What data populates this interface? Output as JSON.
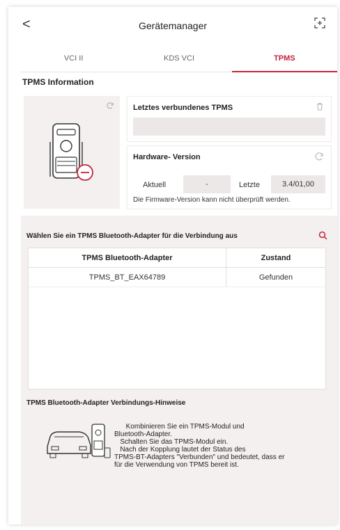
{
  "header": {
    "title": "Gerätemanager",
    "back_glyph": "<"
  },
  "tabs": [
    {
      "label": "VCI II",
      "active": false
    },
    {
      "label": "KDS VCI",
      "active": false
    },
    {
      "label": "TPMS",
      "active": true
    }
  ],
  "tpms_info": {
    "section_title": "TPMS Information",
    "last_connected_label": "Letztes verbundenes TPMS",
    "last_connected_value": "",
    "hardware_label": "Hardware- Version",
    "current_label": "Aktuell",
    "current_value": "-",
    "latest_label": "Letzte",
    "latest_value": "3.4/01,00",
    "firmware_note": "Die Firmware-Version kann nicht überprüft werden."
  },
  "adapter": {
    "select_title": "Wählen Sie ein TPMS Bluetooth-Adapter für die Verbindung aus",
    "col_adapter": "TPMS Bluetooth-Adapter",
    "col_status": "Zustand",
    "rows": [
      {
        "name": "TPMS_BT_EAX64789",
        "status": "Gefunden"
      }
    ]
  },
  "hints": {
    "title": "TPMS Bluetooth-Adapter Verbindungs-Hinweise",
    "lines": [
      "      Kombinieren Sie ein TPMS-Modul und",
      "Bluetooth-Adapter.",
      "   Schalten Sie das TPMS-Modul ein.",
      "   Nach der Kopplung lautet der Status des",
      "TPMS-BT-Adapters \"Verbunden\" und bedeutet, dass er",
      "für die Verwendung von TPMS bereit ist."
    ]
  },
  "colors": {
    "accent": "#c4233a",
    "panel_bg": "#f4f0f0"
  },
  "icons": {
    "back": "chevron-left-icon",
    "expand": "expand-icon",
    "refresh": "refresh-icon",
    "delete": "trash-icon",
    "check_update": "update-check-icon",
    "search": "search-icon"
  }
}
